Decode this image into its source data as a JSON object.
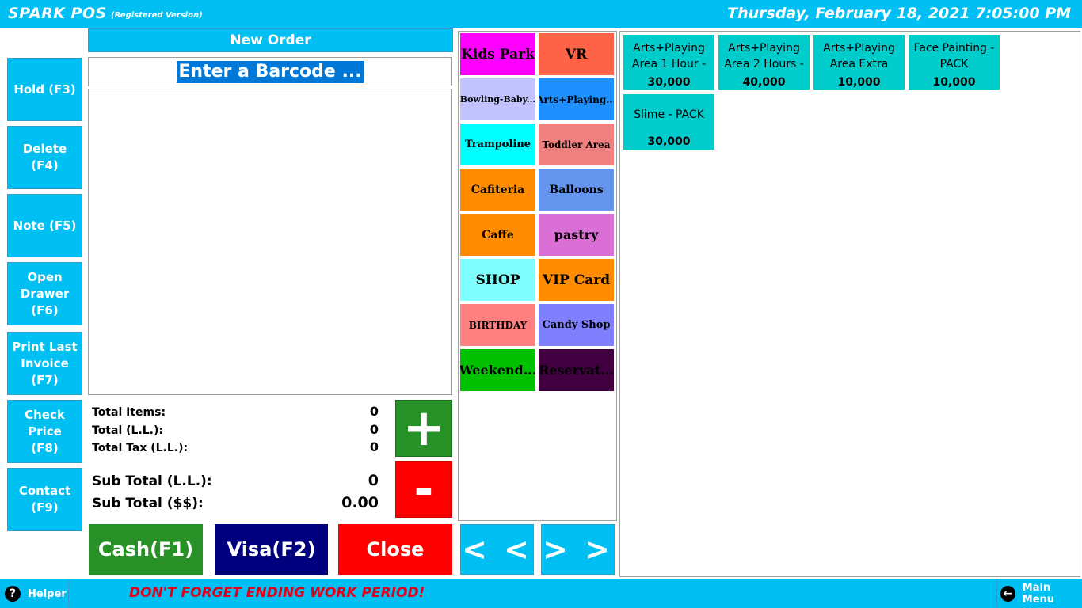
{
  "header": {
    "app_title": "SPARK POS",
    "version": "(Registered Version)",
    "datetime": "Thursday, February 18, 2021 7:05:00 PM"
  },
  "colors": {
    "brand": "#00bff3",
    "cash": "#279027",
    "visa": "#00007f",
    "close": "#ff0000",
    "product": "#00cccc"
  },
  "sidebar": {
    "buttons": [
      {
        "label": "Hold (F3)"
      },
      {
        "label": "Delete\n(F4)"
      },
      {
        "label": "Note (F5)"
      },
      {
        "label": "Open\nDrawer\n(F6)"
      },
      {
        "label": "Print Last\nInvoice\n(F7)"
      },
      {
        "label": "Check\nPrice\n(F8)"
      },
      {
        "label": "Contact\n(F9)"
      }
    ]
  },
  "order": {
    "title": "New Order",
    "barcode_placeholder": "Enter a Barcode ...",
    "totals": {
      "items_label": "Total Items:",
      "items_value": "0",
      "total_label": "Total (L.L.):",
      "total_value": "0",
      "tax_label": "Total Tax (L.L.):",
      "tax_value": "0",
      "subtotal_ll_label": "Sub Total (L.L.):",
      "subtotal_ll_value": "0",
      "subtotal_usd_label": "Sub Total ($$):",
      "subtotal_usd_value": "0.00"
    },
    "plus_label": "+",
    "minus_label": "-"
  },
  "payment": {
    "cash_label": "Cash(F1)",
    "visa_label": "Visa(F2)",
    "close_label": "Close"
  },
  "categories": [
    {
      "label": "Kids Park",
      "color": "#ff00ff",
      "size": "17px"
    },
    {
      "label": "VR",
      "color": "#ff6347",
      "size": "17px"
    },
    {
      "label": "Bowling-Baby...",
      "color": "#c3c3ff",
      "size": "11px"
    },
    {
      "label": "Arts+Playing...",
      "color": "#1e90ff",
      "size": "12px"
    },
    {
      "label": "Trampoline",
      "color": "#00ffff",
      "size": "13px"
    },
    {
      "label": "Toddler Area",
      "color": "#f08080",
      "size": "12px"
    },
    {
      "label": "Cafiteria",
      "color": "#ff8c00",
      "size": "14px"
    },
    {
      "label": "Balloons",
      "color": "#6495ed",
      "size": "14px"
    },
    {
      "label": "Caffe",
      "color": "#ff8c00",
      "size": "14px"
    },
    {
      "label": "pastry",
      "color": "#da70d6",
      "size": "16px"
    },
    {
      "label": "SHOP",
      "color": "#80ffff",
      "size": "17px"
    },
    {
      "label": "VIP Card",
      "color": "#ff8c00",
      "size": "17px"
    },
    {
      "label": "BIRTHDAY",
      "color": "#ff8080",
      "size": "12px"
    },
    {
      "label": "Candy Shop",
      "color": "#8080ff",
      "size": "13px"
    },
    {
      "label": "Weekend...",
      "color": "#00c000",
      "size": "16px"
    },
    {
      "label": "Reservat...",
      "color": "#400040",
      "size": "16px"
    }
  ],
  "nav": {
    "prev_label": "< <",
    "next_label": "> >"
  },
  "products": [
    {
      "name": "Arts+Playing\nArea 1 Hour -",
      "price": "30,000"
    },
    {
      "name": "Arts+Playing\nArea 2 Hours -",
      "price": "40,000"
    },
    {
      "name": "Arts+Playing\nArea Extra",
      "price": "10,000"
    },
    {
      "name": "Face Painting -\nPACK",
      "price": "10,000"
    },
    {
      "name": "Slime - PACK",
      "price": "30,000"
    }
  ],
  "footer": {
    "helper_label": "Helper",
    "helper_icon": "?",
    "warning": "DON'T FORGET ENDING WORK PERIOD!",
    "mainmenu_label": "Main Menu",
    "mainmenu_icon": "←"
  }
}
